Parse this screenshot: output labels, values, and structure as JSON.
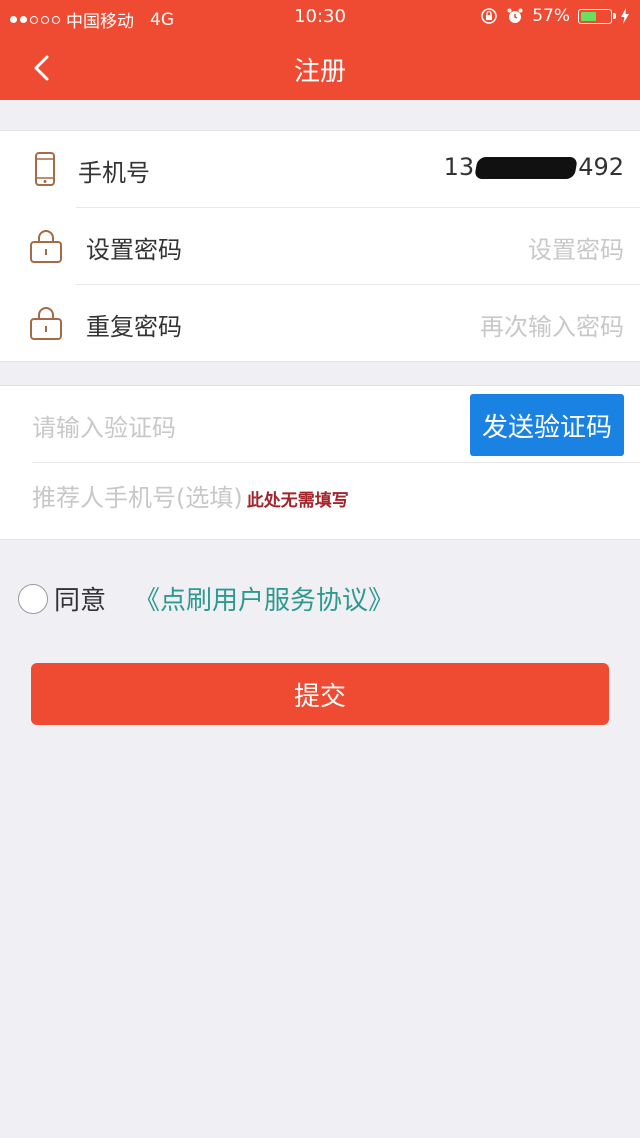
{
  "status_bar": {
    "carrier": "中国移动",
    "network": "4G",
    "time": "10:30",
    "battery_text": "57%",
    "battery_level": 0.57
  },
  "nav": {
    "title": "注册"
  },
  "form": {
    "phone": {
      "label": "手机号",
      "value_prefix": "13",
      "value_suffix": "492"
    },
    "password": {
      "label": "设置密码",
      "placeholder": "设置密码"
    },
    "repeat_password": {
      "label": "重复密码",
      "placeholder": "再次输入密码"
    },
    "verification": {
      "placeholder": "请输入验证码",
      "send_label": "发送验证码"
    },
    "referrer": {
      "placeholder": "推荐人手机号(选填)",
      "note": "此处无需填写"
    }
  },
  "agreement": {
    "agree_label": "同意",
    "link_label": "《点刷用户服务协议》"
  },
  "submit": {
    "label": "提交"
  },
  "colors": {
    "brand": "#ef4a32",
    "send_button": "#1a82e3",
    "link": "#2e9a8f",
    "note": "#a3242a",
    "background": "#efeff4"
  }
}
